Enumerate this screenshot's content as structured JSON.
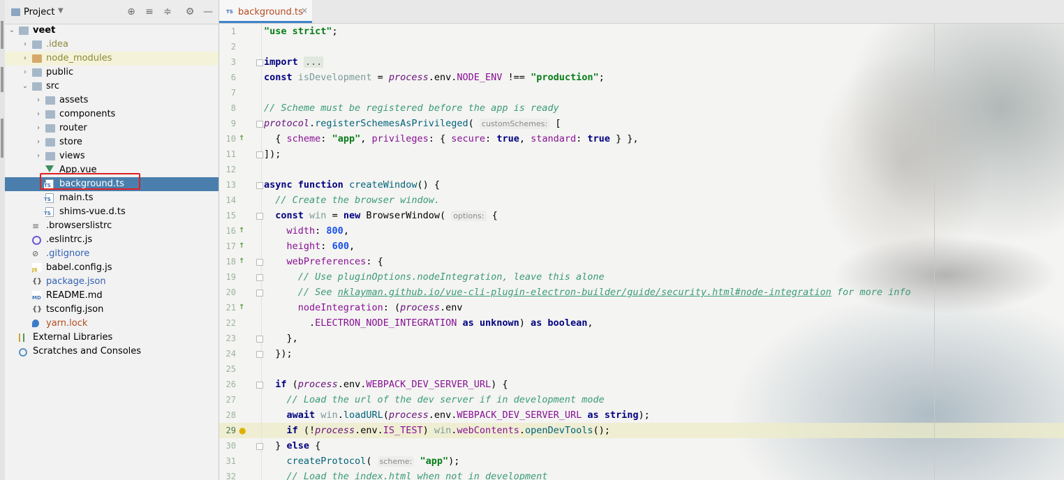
{
  "project_panel": {
    "title": "Project",
    "tree": [
      {
        "label": "veet",
        "depth": 0,
        "kind": "folder-root",
        "expanded": true,
        "bold": true,
        "color": "#000000"
      },
      {
        "label": ".idea",
        "depth": 1,
        "kind": "folder",
        "expanded": false,
        "color": "#8a8a3a"
      },
      {
        "label": "node_modules",
        "depth": 1,
        "kind": "folder-excluded",
        "expanded": false,
        "color": "#8a8a3a",
        "highlight": true
      },
      {
        "label": "public",
        "depth": 1,
        "kind": "folder",
        "expanded": false,
        "color": "#000000"
      },
      {
        "label": "src",
        "depth": 1,
        "kind": "folder",
        "expanded": true,
        "color": "#000000"
      },
      {
        "label": "assets",
        "depth": 2,
        "kind": "folder",
        "expanded": false,
        "color": "#000000"
      },
      {
        "label": "components",
        "depth": 2,
        "kind": "folder",
        "expanded": false,
        "color": "#000000"
      },
      {
        "label": "router",
        "depth": 2,
        "kind": "folder",
        "expanded": false,
        "color": "#000000"
      },
      {
        "label": "store",
        "depth": 2,
        "kind": "folder",
        "expanded": false,
        "color": "#000000"
      },
      {
        "label": "views",
        "depth": 2,
        "kind": "folder",
        "expanded": false,
        "color": "#000000"
      },
      {
        "label": "App.vue",
        "depth": 2,
        "kind": "vue",
        "color": "#000000"
      },
      {
        "label": "background.ts",
        "depth": 2,
        "kind": "ts",
        "color": "#ffffff",
        "selected": true
      },
      {
        "label": "main.ts",
        "depth": 2,
        "kind": "ts",
        "color": "#000000"
      },
      {
        "label": "shims-vue.d.ts",
        "depth": 2,
        "kind": "ts",
        "color": "#000000"
      },
      {
        "label": ".browserslistrc",
        "depth": 1,
        "kind": "lines",
        "color": "#000000"
      },
      {
        "label": ".eslintrc.js",
        "depth": 1,
        "kind": "circle",
        "color": "#000000"
      },
      {
        "label": ".gitignore",
        "depth": 1,
        "kind": "gitic",
        "color": "#2f5fb3"
      },
      {
        "label": "babel.config.js",
        "depth": 1,
        "kind": "js",
        "color": "#000000"
      },
      {
        "label": "package.json",
        "depth": 1,
        "kind": "json",
        "color": "#2f5fb3"
      },
      {
        "label": "README.md",
        "depth": 1,
        "kind": "md",
        "color": "#000000"
      },
      {
        "label": "tsconfig.json",
        "depth": 1,
        "kind": "json",
        "color": "#000000"
      },
      {
        "label": "yarn.lock",
        "depth": 1,
        "kind": "yarn",
        "color": "#b54a1e"
      },
      {
        "label": "External Libraries",
        "depth": 0,
        "kind": "lib",
        "color": "#000000"
      },
      {
        "label": "Scratches and Consoles",
        "depth": 0,
        "kind": "scr",
        "color": "#000000"
      }
    ]
  },
  "editor": {
    "tab": {
      "filename": "background.ts",
      "badge": "TS",
      "close": "×"
    },
    "current_line": 29,
    "lines": [
      {
        "n": "1",
        "html": "<span class='s'>\"use strict\"</span>;"
      },
      {
        "n": "2",
        "html": ""
      },
      {
        "n": "3",
        "html": "<span class='k'>import</span> <span class='fold-box'>...</span>",
        "fold": true
      },
      {
        "n": "6",
        "html": "<span class='k'>const</span> <span class='v'>isDevelopment</span> = <span class='i'>process</span>.env.<span class='p'>NODE_ENV</span> !== <span class='s'>\"production\"</span>;"
      },
      {
        "n": "7",
        "html": ""
      },
      {
        "n": "8",
        "html": "<span class='c'>// Scheme must be registered before the app is ready</span>"
      },
      {
        "n": "9",
        "html": "<span class='i'>protocol</span>.<span class='f'>registerSchemesAsPrivileged</span>( <span class='hint'>customSchemes:</span> [",
        "fold": true
      },
      {
        "n": "10",
        "html": "  { <span class='p'>scheme</span>: <span class='s'>\"app\"</span>, <span class='p'>privileges</span>: { <span class='p'>secure</span>: <span class='k'>true</span>, <span class='p'>standard</span>: <span class='k'>true</span> } },",
        "marker": "ī↑"
      },
      {
        "n": "11",
        "html": "]);",
        "fold": true
      },
      {
        "n": "12",
        "html": ""
      },
      {
        "n": "13",
        "html": "<span class='k'>async function</span> <span class='f'>createWindow</span>() {",
        "fold": true
      },
      {
        "n": "14",
        "html": "  <span class='c'>// Create the browser window.</span>"
      },
      {
        "n": "15",
        "html": "  <span class='k'>const</span> <span class='v'>win</span> = <span class='k'>new</span> BrowserWindow( <span class='hint'>options:</span> {",
        "fold": true
      },
      {
        "n": "16",
        "html": "    <span class='p'>width</span>: <span class='n'>800</span>,",
        "marker": "ī↑"
      },
      {
        "n": "17",
        "html": "    <span class='p'>height</span>: <span class='n'>600</span>,",
        "marker": "ī↑"
      },
      {
        "n": "18",
        "html": "    <span class='p'>webPreferences</span>: {",
        "marker": "ī↑",
        "fold": true
      },
      {
        "n": "19",
        "html": "      <span class='c'>// Use pluginOptions.nodeIntegration, leave this alone</span>",
        "fold": true
      },
      {
        "n": "20",
        "html": "      <span class='c'>// See <span class='underline'>nklayman.github.io/vue-cli-plugin-electron-builder/guide/security.html#node-integration</span> for more info</span>",
        "fold": true
      },
      {
        "n": "21",
        "html": "      <span class='p'>nodeIntegration</span>: (<span class='i'>process</span>.env",
        "marker": "ī↑"
      },
      {
        "n": "22",
        "html": "        .<span class='p'>ELECTRON_NODE_INTEGRATION</span> <span class='k'>as unknown</span>) <span class='k'>as boolean</span>,"
      },
      {
        "n": "23",
        "html": "    },",
        "fold": true
      },
      {
        "n": "24",
        "html": "  });",
        "fold": true
      },
      {
        "n": "25",
        "html": ""
      },
      {
        "n": "26",
        "html": "  <span class='k'>if</span> (<span class='i'>process</span>.env.<span class='p'>WEBPACK_DEV_SERVER_URL</span>) {",
        "fold": true
      },
      {
        "n": "27",
        "html": "    <span class='c'>// Load the url of the dev server if in development mode</span>"
      },
      {
        "n": "28",
        "html": "    <span class='k'>await</span> <span class='v'>win</span>.<span class='f'>loadURL</span>(<span class='i'>process</span>.env.<span class='p'>WEBPACK_DEV_SERVER_URL</span> <span class='k'>as string</span>);"
      },
      {
        "n": "29",
        "html": "    <span class='k'>if</span> (!<span class='i'>process</span>.env.<span class='p'>IS_TEST</span>) <span class='v'>win</span>.<span class='p'>webContents</span>.<span class='f'>openDevTools</span>();",
        "marker": "bulb"
      },
      {
        "n": "30",
        "html": "  } <span class='k'>else</span> {",
        "fold": true
      },
      {
        "n": "31",
        "html": "    <span class='f'>createProtocol</span>( <span class='hint'>scheme:</span> <span class='s'>\"app\"</span>);"
      },
      {
        "n": "32",
        "html": "    <span class='c'>// Load the index.html when not in development</span>"
      }
    ]
  },
  "colors": {
    "selection": "#4a7fad",
    "tab_underline": "#4083c9",
    "annotation_box": "#e02020"
  }
}
